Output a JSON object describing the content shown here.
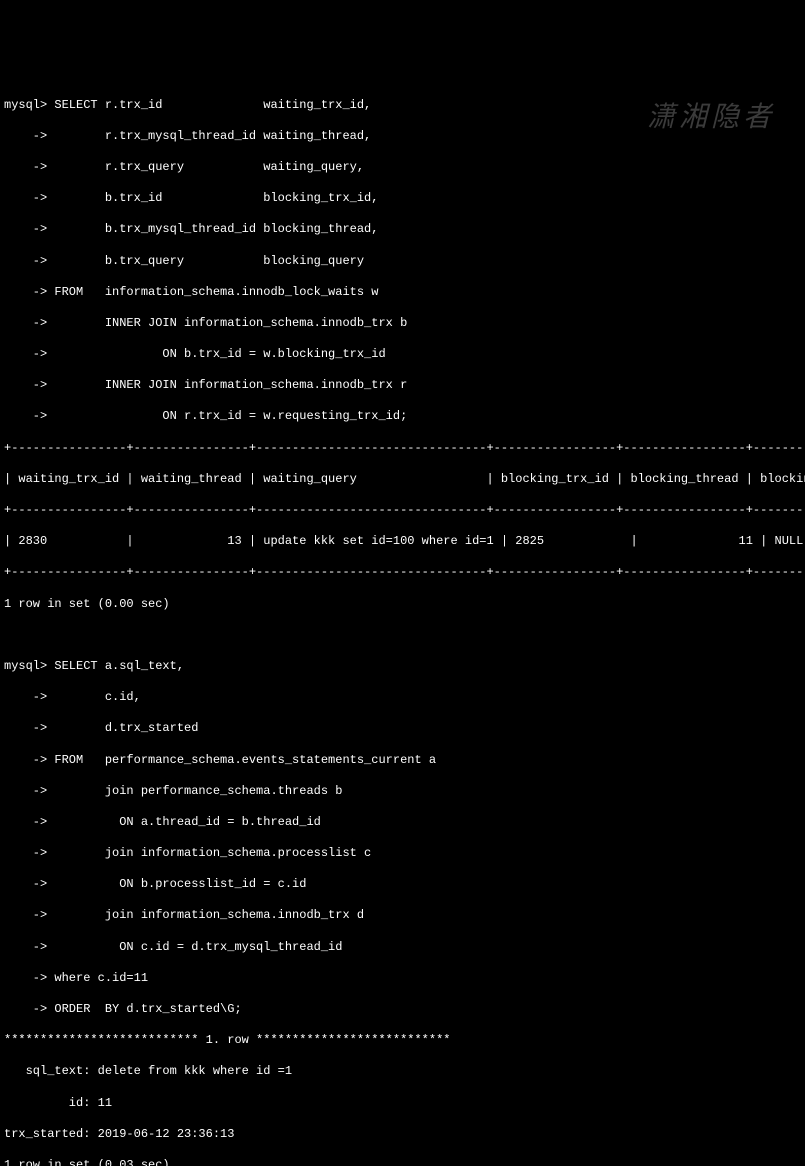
{
  "watermark": "潇湘隐者",
  "query1": {
    "l01": "mysql> SELECT r.trx_id              waiting_trx_id,",
    "l02": "    ->        r.trx_mysql_thread_id waiting_thread,",
    "l03": "    ->        r.trx_query           waiting_query,",
    "l04": "    ->        b.trx_id              blocking_trx_id,",
    "l05": "    ->        b.trx_mysql_thread_id blocking_thread,",
    "l06": "    ->        b.trx_query           blocking_query",
    "l07": "    -> FROM   information_schema.innodb_lock_waits w",
    "l08": "    ->        INNER JOIN information_schema.innodb_trx b",
    "l09": "    ->                ON b.trx_id = w.blocking_trx_id",
    "l10": "    ->        INNER JOIN information_schema.innodb_trx r",
    "l11": "    ->                ON r.trx_id = w.requesting_trx_id;"
  },
  "table1": {
    "border": "+----------------+----------------+--------------------------------+-----------------+-----------------+---------",
    "header": "| waiting_trx_id | waiting_thread | waiting_query                  | blocking_trx_id | blocking_thread | blocking",
    "row": "| 2830           |             13 | update kkk set id=100 where id=1 | 2825            |              11 | NULL   "
  },
  "result1": "1 row in set (0.00 sec)",
  "query2": {
    "l01": "mysql> SELECT a.sql_text,",
    "l02": "    ->        c.id,",
    "l03": "    ->        d.trx_started",
    "l04": "    -> FROM   performance_schema.events_statements_current a",
    "l05": "    ->        join performance_schema.threads b",
    "l06": "    ->          ON a.thread_id = b.thread_id",
    "l07": "    ->        join information_schema.processlist c",
    "l08": "    ->          ON b.processlist_id = c.id",
    "l09": "    ->        join information_schema.innodb_trx d",
    "l10": "    ->          ON c.id = d.trx_mysql_thread_id",
    "l11": "    -> where c.id=11",
    "l12": "    -> ORDER  BY d.trx_started\\G;"
  },
  "result2": {
    "header": "*************************** 1. row ***************************",
    "sql_text": "   sql_text: delete from kkk where id =1",
    "id": "         id: 11",
    "trx": "trx_started: 2019-06-12 23:36:13",
    "footer": "1 row in set (0.03 sec)"
  }
}
